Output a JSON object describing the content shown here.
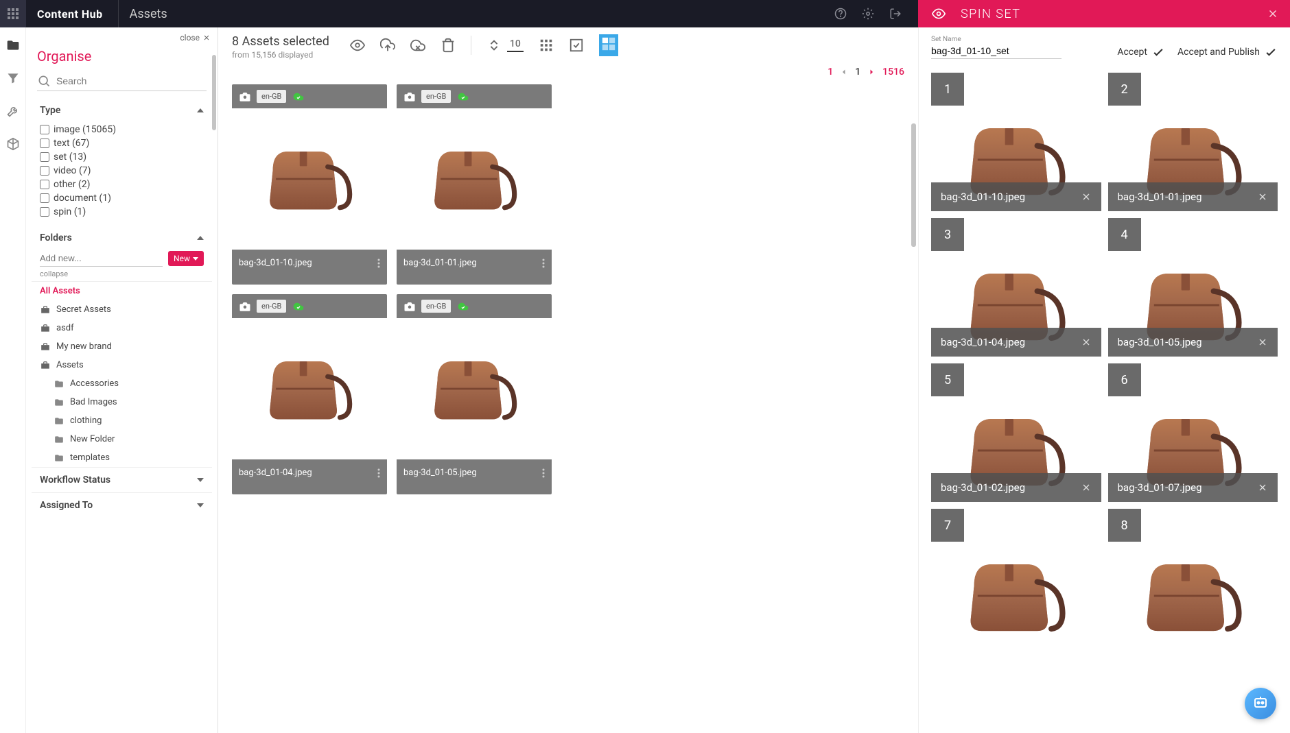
{
  "brand": "Content Hub",
  "page_title": "Assets",
  "spin_header": "SPIN SET",
  "organise": {
    "title": "Organise",
    "close": "close",
    "search_placeholder": "Search",
    "type_label": "Type",
    "types": [
      {
        "label": "image (15065)"
      },
      {
        "label": "text (67)"
      },
      {
        "label": "set (13)"
      },
      {
        "label": "video (7)"
      },
      {
        "label": "other (2)"
      },
      {
        "label": "document (1)"
      },
      {
        "label": "spin (1)"
      }
    ],
    "folders_label": "Folders",
    "add_new_placeholder": "Add new...",
    "new_btn": "New",
    "collapse_label": "collapse",
    "folders": [
      {
        "label": "All Assets",
        "active": true,
        "icon": "none"
      },
      {
        "label": "Secret Assets",
        "icon": "case"
      },
      {
        "label": "asdf",
        "icon": "case"
      },
      {
        "label": "My new brand",
        "icon": "case"
      },
      {
        "label": "Assets",
        "icon": "case"
      },
      {
        "label": "Accessories",
        "icon": "folder",
        "sub": true
      },
      {
        "label": "Bad Images",
        "icon": "folder",
        "sub": true
      },
      {
        "label": "clothing",
        "icon": "folder",
        "sub": true
      },
      {
        "label": "New Folder",
        "icon": "folder",
        "sub": true
      },
      {
        "label": "templates",
        "icon": "folder",
        "sub": true
      }
    ],
    "workflow_label": "Workflow Status",
    "assigned_label": "Assigned To"
  },
  "toolbar": {
    "selected": "8 Assets selected",
    "displayed": "from 15,156 displayed",
    "page_size": "10",
    "page_current": "1",
    "page_mid": "1",
    "page_total": "1516"
  },
  "cards": [
    {
      "locale": "en-GB",
      "name": "bag-3d_01-10.jpeg"
    },
    {
      "locale": "en-GB",
      "name": "bag-3d_01-01.jpeg"
    },
    {
      "locale": "en-GB",
      "name": "bag-3d_01-04.jpeg"
    },
    {
      "locale": "en-GB",
      "name": "bag-3d_01-05.jpeg"
    }
  ],
  "spin": {
    "set_name_label": "Set Name",
    "set_name_value": "bag-3d_01-10_set",
    "accept": "Accept",
    "accept_publish": "Accept and Publish",
    "items": [
      {
        "num": "1",
        "name": "bag-3d_01-10.jpeg"
      },
      {
        "num": "2",
        "name": "bag-3d_01-01.jpeg"
      },
      {
        "num": "3",
        "name": "bag-3d_01-04.jpeg"
      },
      {
        "num": "4",
        "name": "bag-3d_01-05.jpeg"
      },
      {
        "num": "5",
        "name": "bag-3d_01-02.jpeg"
      },
      {
        "num": "6",
        "name": "bag-3d_01-07.jpeg"
      },
      {
        "num": "7",
        "name": ""
      },
      {
        "num": "8",
        "name": ""
      }
    ]
  }
}
